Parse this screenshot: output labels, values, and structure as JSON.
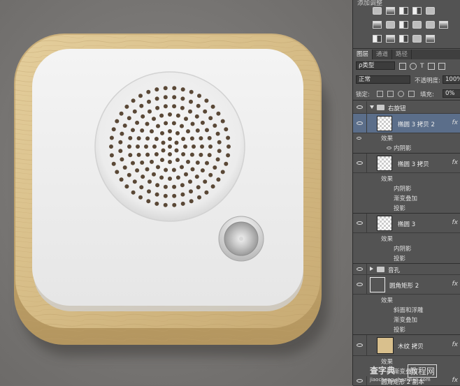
{
  "adjustments": {
    "title": "添加调整",
    "row1_icons": [
      "brightness-icon",
      "levels-icon",
      "curves-icon",
      "exposure-icon",
      "vibrance-icon"
    ],
    "row2_icons": [
      "hue-icon",
      "balance-icon",
      "bw-icon",
      "photo-filter-icon",
      "channel-mixer-icon",
      "lookup-icon"
    ],
    "row3_icons": [
      "invert-icon",
      "posterize-icon",
      "threshold-icon",
      "selective-color-icon",
      "gradient-map-icon"
    ]
  },
  "tabs": [
    "图层",
    "通道",
    "路径"
  ],
  "filter": {
    "kind": "ρ类型"
  },
  "blend_mode": "正常",
  "opacity": {
    "label": "不透明度:",
    "value": "100%"
  },
  "lock": {
    "label": "锁定:"
  },
  "fill": {
    "label": "填充:",
    "value": "0%"
  },
  "layers": [
    {
      "name": "右旋钮",
      "type": "group"
    },
    {
      "name": "椭圆 3 拷贝 2",
      "fx": "fx",
      "selected": true
    },
    {
      "effect_header": "效果"
    },
    {
      "effect": "内阴影"
    },
    {
      "name": "椭圆 3 拷贝",
      "fx": "fx"
    },
    {
      "effect_header": "效果"
    },
    {
      "effect": "内阴影"
    },
    {
      "effect": "渐变叠加"
    },
    {
      "effect": "投影"
    },
    {
      "name": "椭圆 3",
      "fx": "fx"
    },
    {
      "effect_header": "效果"
    },
    {
      "effect": "内阴影"
    },
    {
      "effect": "投影"
    },
    {
      "name": "音孔",
      "type": "group"
    },
    {
      "name": "圆角矩形 2",
      "fx": "fx"
    },
    {
      "effect_header": "效果"
    },
    {
      "effect": "斜面和浮雕"
    },
    {
      "effect": "渐变叠加"
    },
    {
      "effect": "投影"
    },
    {
      "name": "木纹 拷贝",
      "fx": "fx"
    },
    {
      "effect_header": "效果"
    },
    {
      "effect": "渐变叠加"
    },
    {
      "name": "圆角矩形 2 副本",
      "fx": "fx"
    }
  ],
  "watermark": {
    "site": "查字典",
    "label": "教程网",
    "url": "jiaocheng.chazidian.com"
  },
  "colors": {
    "wood": "#d9c08d",
    "panel": "#ededed",
    "speaker_hole": "#5a4836",
    "selected_row": "#5b6e8a"
  }
}
